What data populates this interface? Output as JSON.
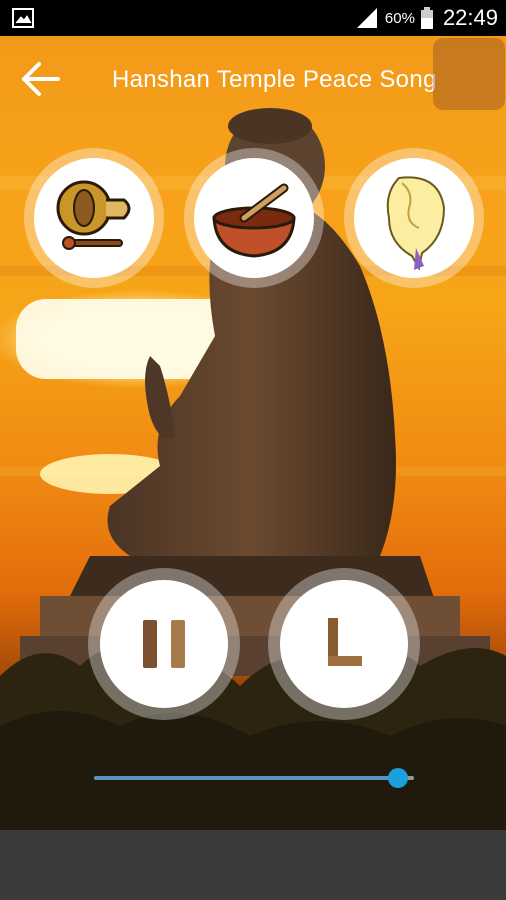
{
  "status_bar": {
    "battery_percent": "60%",
    "time": "22:49",
    "icons": [
      "image-icon",
      "signal-icon",
      "battery-icon"
    ]
  },
  "toolbar": {
    "title": "Hanshan Temple Peace Song",
    "back_icon": "back-arrow-icon"
  },
  "instruments": [
    {
      "name": "gong",
      "icon": "gong-icon"
    },
    {
      "name": "singing bowl",
      "icon": "singing-bowl-icon"
    },
    {
      "name": "conch shell",
      "icon": "conch-shell-icon"
    }
  ],
  "controls": {
    "pause_icon": "pause-icon",
    "timer_icon": "timer-icon"
  },
  "playback": {
    "progress": 0.95
  },
  "colors": {
    "sky_orange": "#f6a418",
    "slider_thumb": "#1aa0db",
    "bottom_bar": "#3a3a3a"
  }
}
